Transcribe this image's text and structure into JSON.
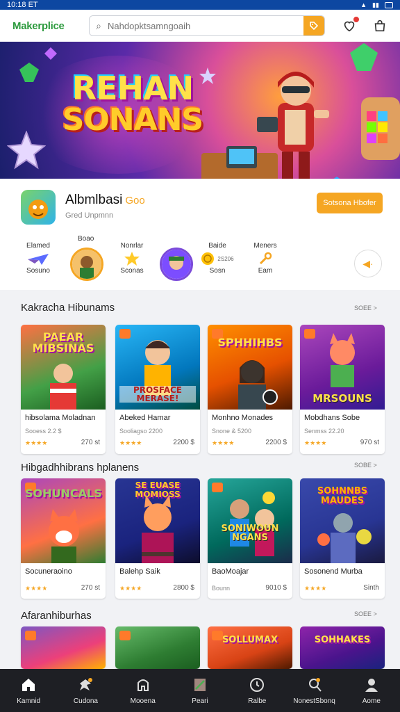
{
  "status": {
    "time": "10:18 ET"
  },
  "header": {
    "logo": "Makerplice",
    "search_placeholder": "Nahdopktsamngoaih"
  },
  "app": {
    "name": "Albmlbasi",
    "tag": "Goo",
    "subtitle": "Gred Unpmnn",
    "cta": "Sotsona Hbofer"
  },
  "categories": [
    {
      "top": "Elamed",
      "bottom": "Sosuno",
      "icon": "airplane-icon"
    },
    {
      "top": "Boao",
      "bottom": "",
      "icon": "avatar"
    },
    {
      "top": "Nonrlar",
      "bottom": "Sconas",
      "icon": "star-icon"
    },
    {
      "top": "",
      "bottom": "",
      "icon": "avatar"
    },
    {
      "top": "Baide",
      "bottom": "Sosn",
      "icon": "coin-icon",
      "extra": "2S206"
    },
    {
      "top": "Meners",
      "bottom": "Eam",
      "icon": "wrench-icon"
    }
  ],
  "sections": [
    {
      "title": "Kakracha Hibunams",
      "see_more": "SOEE >",
      "cards": [
        {
          "thumb_text": "PAEAR MIBSINAS",
          "title": "hibsolama Moladnan",
          "meta": "Sooess 2.2 $",
          "stars": "★★★★",
          "price": "270 st"
        },
        {
          "thumb_text": "",
          "thumb_text2": "PROSFACE MERASE!",
          "title": "Abeked Hamar",
          "meta": "Sooliagso 2200",
          "stars": "★★★★",
          "price": "2200 $"
        },
        {
          "thumb_text": "SPHHIHBS",
          "title": "Monhno Monades",
          "meta": "Snone & 5200",
          "stars": "★★★★",
          "price": "2200 $"
        },
        {
          "thumb_text": "",
          "thumb_text2": "MRSOUNS",
          "title": "Mobdhans Sobe",
          "meta": "Senmss 22.20",
          "stars": "★★★★",
          "price": "970 st"
        }
      ]
    },
    {
      "title": "Hibgadhhibrans hplanens",
      "see_more": "SOBE >",
      "cards": [
        {
          "thumb_text": "SOHUNCALS",
          "title": "Socuneraoino",
          "stars": "★★★★",
          "price": "270 st"
        },
        {
          "thumb_text": "SE EUASE MOMIOSS",
          "title": "Balehp Saik",
          "stars": "★★★★",
          "price": "2800 $"
        },
        {
          "thumb_text": "",
          "thumb_text2": "SONIWOUN NGANS",
          "title": "BaoMoajar",
          "stars": "Bounn",
          "price": "9010 $"
        },
        {
          "thumb_text": "SOHNNBS MAUDES",
          "title": "Sosonend Murba",
          "stars": "★★★★",
          "price": "Sinth"
        }
      ]
    },
    {
      "title": "Afaranhiburhas",
      "see_more": "SOEE >",
      "cards": [
        {
          "thumb_text": ""
        },
        {
          "thumb_text": ""
        },
        {
          "thumb_text": "SOLLUMAX"
        },
        {
          "thumb_text": "SOHHAKES"
        }
      ]
    }
  ],
  "nav": [
    {
      "label": "Kamnid",
      "icon": "home-icon"
    },
    {
      "label": "Cudona",
      "icon": "puzzle-icon"
    },
    {
      "label": "Mooena",
      "icon": "store-icon"
    },
    {
      "label": "Peari",
      "icon": "map-icon"
    },
    {
      "label": "Ralbe",
      "icon": "clock-icon"
    },
    {
      "label": "NonestSbonq",
      "icon": "location-icon"
    },
    {
      "label": "Aome",
      "icon": "profile-icon"
    }
  ],
  "colors": {
    "accent": "#f5a623",
    "brand_green": "#2e9b3f",
    "status_bar": "#0d47a1",
    "nav_bg": "#1e1f24"
  }
}
